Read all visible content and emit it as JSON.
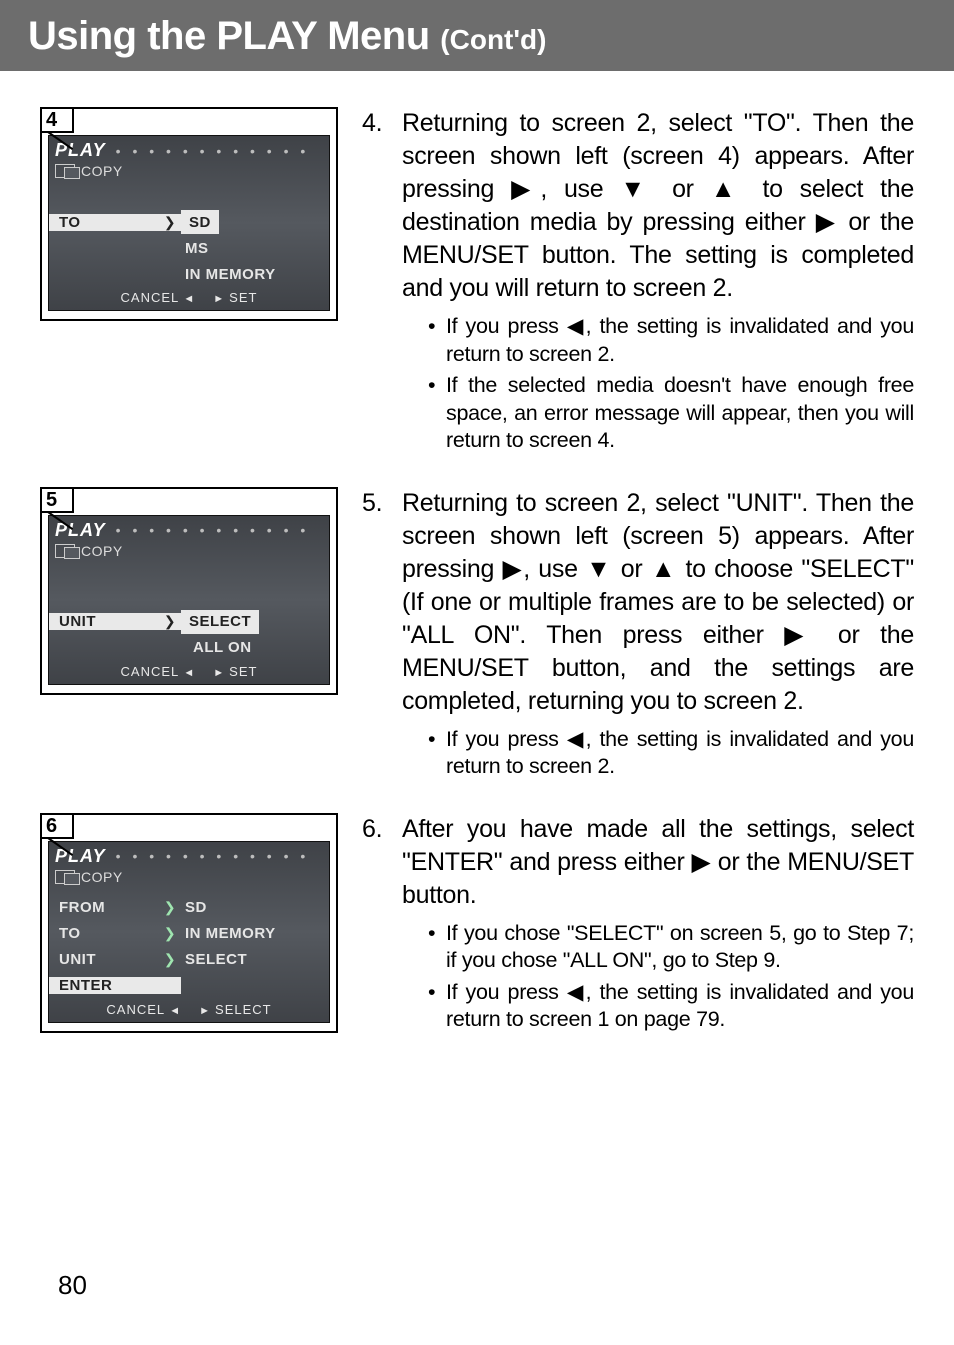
{
  "header": {
    "title_main": "Using the PLAY Menu ",
    "title_sub": "(Cont'd)"
  },
  "page_number": "80",
  "glyphs": {
    "right": "▶",
    "left": "◀",
    "down": "▼",
    "up": "▲"
  },
  "screens": {
    "s4": {
      "tag": "4",
      "play": "PLAY",
      "copy": "COPY",
      "rows": [
        {
          "label": "TO",
          "arrow": "❯",
          "value": "SD",
          "sel_label": true,
          "sel_value": true
        },
        {
          "label": "",
          "arrow": "",
          "value": "MS"
        },
        {
          "label": "",
          "arrow": "",
          "value": "IN MEMORY"
        }
      ],
      "footer": {
        "cancel": "CANCEL",
        "set": "SET"
      }
    },
    "s5": {
      "tag": "5",
      "play": "PLAY",
      "copy": "COPY",
      "rows": [
        {
          "label": "UNIT",
          "arrow": "❯",
          "value": "SELECT",
          "sel_label": true,
          "sel_value": true
        },
        {
          "label": "",
          "arrow": "",
          "value": "ALL ON"
        }
      ],
      "footer": {
        "cancel": "CANCEL",
        "set": "SET"
      }
    },
    "s6": {
      "tag": "6",
      "play": "PLAY",
      "copy": "COPY",
      "rows": [
        {
          "label": "FROM",
          "arrow": "❯",
          "value": "SD"
        },
        {
          "label": "TO",
          "arrow": "❯",
          "value": "IN MEMORY"
        },
        {
          "label": "UNIT",
          "arrow": "❯",
          "value": "SELECT"
        },
        {
          "label": "ENTER",
          "arrow": "",
          "value": "",
          "sel_label": true
        }
      ],
      "footer": {
        "cancel": "CANCEL",
        "set": "SELECT"
      }
    }
  },
  "steps": {
    "s4": {
      "num": "4",
      "text_a": "Returning to screen 2, select \"TO\". Then the screen shown left (screen 4) appears. After pressing ",
      "text_b": ", use ",
      "text_c": " or ",
      "text_d": " to select the destination media by pressing either ",
      "text_e": " or the MENU/SET button. The setting is completed and you will return to screen 2.",
      "bullets": [
        {
          "a": "If you press ",
          "b": ", the setting is invalidated and you return to screen 2."
        },
        {
          "a": "If the selected media doesn't have enough free space, an error message will appear, then you will return to screen 4."
        }
      ]
    },
    "s5": {
      "num": "5",
      "text_a": "Returning to screen 2, select \"UNIT\". Then the screen shown left (screen 5) appears. After pressing ",
      "text_b": ", use ",
      "text_c": " or ",
      "text_d": " to choose \"SELECT\" (If one or multiple frames are to be selected) or \"ALL ON\". Then press either ",
      "text_e": " or the MENU/SET button, and the settings are completed, returning you to screen 2.",
      "bullets": [
        {
          "a": "If you press ",
          "b": ", the setting is invalidated and you return to screen 2."
        }
      ]
    },
    "s6": {
      "num": "6",
      "text_a": "After you have made all the settings, select \"ENTER\" and press either ",
      "text_b": " or the MENU/SET button.",
      "bullets": [
        {
          "a": "If you chose \"SELECT\" on screen 5, go to Step 7; if you chose \"ALL ON\", go to Step 9."
        },
        {
          "a": "If you press ",
          "b": ", the setting is invalidated and you return to screen 1 on page 79."
        }
      ]
    }
  }
}
